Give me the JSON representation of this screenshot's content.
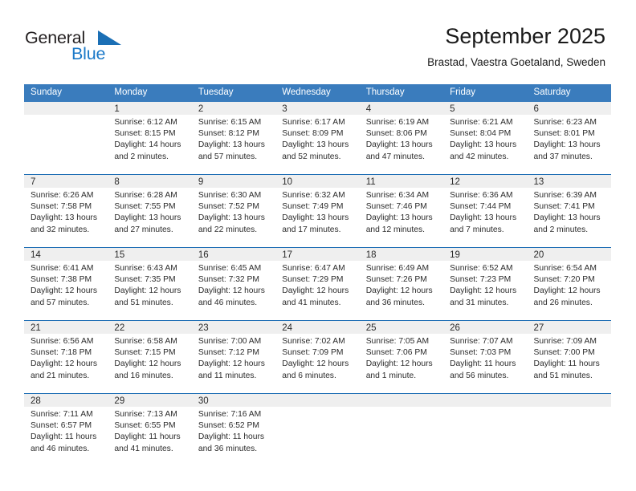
{
  "brand": {
    "name_part1": "General",
    "name_part2": "Blue",
    "triangle_icon": "triangle-icon",
    "color_dark": "#231f20",
    "color_blue": "#1b79c8"
  },
  "header": {
    "title": "September 2025",
    "subtitle": "Brastad, Vaestra Goetaland, Sweden"
  },
  "theme": {
    "header_bg": "#3a7cbd",
    "week_separator": "#1f6fb5",
    "daynum_bg": "#efefef",
    "text": "#2b2b2b"
  },
  "calendar": {
    "weekday_headers": [
      "Sunday",
      "Monday",
      "Tuesday",
      "Wednesday",
      "Thursday",
      "Friday",
      "Saturday"
    ],
    "weeks": [
      [
        {
          "day": "",
          "sunrise": "",
          "sunset": "",
          "daylight_line1": "",
          "daylight_line2": "",
          "empty": true,
          "shaded": true
        },
        {
          "day": "1",
          "sunrise": "Sunrise: 6:12 AM",
          "sunset": "Sunset: 8:15 PM",
          "daylight_line1": "Daylight: 14 hours",
          "daylight_line2": "and 2 minutes."
        },
        {
          "day": "2",
          "sunrise": "Sunrise: 6:15 AM",
          "sunset": "Sunset: 8:12 PM",
          "daylight_line1": "Daylight: 13 hours",
          "daylight_line2": "and 57 minutes."
        },
        {
          "day": "3",
          "sunrise": "Sunrise: 6:17 AM",
          "sunset": "Sunset: 8:09 PM",
          "daylight_line1": "Daylight: 13 hours",
          "daylight_line2": "and 52 minutes."
        },
        {
          "day": "4",
          "sunrise": "Sunrise: 6:19 AM",
          "sunset": "Sunset: 8:06 PM",
          "daylight_line1": "Daylight: 13 hours",
          "daylight_line2": "and 47 minutes."
        },
        {
          "day": "5",
          "sunrise": "Sunrise: 6:21 AM",
          "sunset": "Sunset: 8:04 PM",
          "daylight_line1": "Daylight: 13 hours",
          "daylight_line2": "and 42 minutes."
        },
        {
          "day": "6",
          "sunrise": "Sunrise: 6:23 AM",
          "sunset": "Sunset: 8:01 PM",
          "daylight_line1": "Daylight: 13 hours",
          "daylight_line2": "and 37 minutes."
        }
      ],
      [
        {
          "day": "7",
          "sunrise": "Sunrise: 6:26 AM",
          "sunset": "Sunset: 7:58 PM",
          "daylight_line1": "Daylight: 13 hours",
          "daylight_line2": "and 32 minutes."
        },
        {
          "day": "8",
          "sunrise": "Sunrise: 6:28 AM",
          "sunset": "Sunset: 7:55 PM",
          "daylight_line1": "Daylight: 13 hours",
          "daylight_line2": "and 27 minutes."
        },
        {
          "day": "9",
          "sunrise": "Sunrise: 6:30 AM",
          "sunset": "Sunset: 7:52 PM",
          "daylight_line1": "Daylight: 13 hours",
          "daylight_line2": "and 22 minutes."
        },
        {
          "day": "10",
          "sunrise": "Sunrise: 6:32 AM",
          "sunset": "Sunset: 7:49 PM",
          "daylight_line1": "Daylight: 13 hours",
          "daylight_line2": "and 17 minutes."
        },
        {
          "day": "11",
          "sunrise": "Sunrise: 6:34 AM",
          "sunset": "Sunset: 7:46 PM",
          "daylight_line1": "Daylight: 13 hours",
          "daylight_line2": "and 12 minutes."
        },
        {
          "day": "12",
          "sunrise": "Sunrise: 6:36 AM",
          "sunset": "Sunset: 7:44 PM",
          "daylight_line1": "Daylight: 13 hours",
          "daylight_line2": "and 7 minutes."
        },
        {
          "day": "13",
          "sunrise": "Sunrise: 6:39 AM",
          "sunset": "Sunset: 7:41 PM",
          "daylight_line1": "Daylight: 13 hours",
          "daylight_line2": "and 2 minutes."
        }
      ],
      [
        {
          "day": "14",
          "sunrise": "Sunrise: 6:41 AM",
          "sunset": "Sunset: 7:38 PM",
          "daylight_line1": "Daylight: 12 hours",
          "daylight_line2": "and 57 minutes."
        },
        {
          "day": "15",
          "sunrise": "Sunrise: 6:43 AM",
          "sunset": "Sunset: 7:35 PM",
          "daylight_line1": "Daylight: 12 hours",
          "daylight_line2": "and 51 minutes."
        },
        {
          "day": "16",
          "sunrise": "Sunrise: 6:45 AM",
          "sunset": "Sunset: 7:32 PM",
          "daylight_line1": "Daylight: 12 hours",
          "daylight_line2": "and 46 minutes."
        },
        {
          "day": "17",
          "sunrise": "Sunrise: 6:47 AM",
          "sunset": "Sunset: 7:29 PM",
          "daylight_line1": "Daylight: 12 hours",
          "daylight_line2": "and 41 minutes."
        },
        {
          "day": "18",
          "sunrise": "Sunrise: 6:49 AM",
          "sunset": "Sunset: 7:26 PM",
          "daylight_line1": "Daylight: 12 hours",
          "daylight_line2": "and 36 minutes."
        },
        {
          "day": "19",
          "sunrise": "Sunrise: 6:52 AM",
          "sunset": "Sunset: 7:23 PM",
          "daylight_line1": "Daylight: 12 hours",
          "daylight_line2": "and 31 minutes."
        },
        {
          "day": "20",
          "sunrise": "Sunrise: 6:54 AM",
          "sunset": "Sunset: 7:20 PM",
          "daylight_line1": "Daylight: 12 hours",
          "daylight_line2": "and 26 minutes."
        }
      ],
      [
        {
          "day": "21",
          "sunrise": "Sunrise: 6:56 AM",
          "sunset": "Sunset: 7:18 PM",
          "daylight_line1": "Daylight: 12 hours",
          "daylight_line2": "and 21 minutes."
        },
        {
          "day": "22",
          "sunrise": "Sunrise: 6:58 AM",
          "sunset": "Sunset: 7:15 PM",
          "daylight_line1": "Daylight: 12 hours",
          "daylight_line2": "and 16 minutes."
        },
        {
          "day": "23",
          "sunrise": "Sunrise: 7:00 AM",
          "sunset": "Sunset: 7:12 PM",
          "daylight_line1": "Daylight: 12 hours",
          "daylight_line2": "and 11 minutes."
        },
        {
          "day": "24",
          "sunrise": "Sunrise: 7:02 AM",
          "sunset": "Sunset: 7:09 PM",
          "daylight_line1": "Daylight: 12 hours",
          "daylight_line2": "and 6 minutes."
        },
        {
          "day": "25",
          "sunrise": "Sunrise: 7:05 AM",
          "sunset": "Sunset: 7:06 PM",
          "daylight_line1": "Daylight: 12 hours",
          "daylight_line2": "and 1 minute."
        },
        {
          "day": "26",
          "sunrise": "Sunrise: 7:07 AM",
          "sunset": "Sunset: 7:03 PM",
          "daylight_line1": "Daylight: 11 hours",
          "daylight_line2": "and 56 minutes."
        },
        {
          "day": "27",
          "sunrise": "Sunrise: 7:09 AM",
          "sunset": "Sunset: 7:00 PM",
          "daylight_line1": "Daylight: 11 hours",
          "daylight_line2": "and 51 minutes."
        }
      ],
      [
        {
          "day": "28",
          "sunrise": "Sunrise: 7:11 AM",
          "sunset": "Sunset: 6:57 PM",
          "daylight_line1": "Daylight: 11 hours",
          "daylight_line2": "and 46 minutes."
        },
        {
          "day": "29",
          "sunrise": "Sunrise: 7:13 AM",
          "sunset": "Sunset: 6:55 PM",
          "daylight_line1": "Daylight: 11 hours",
          "daylight_line2": "and 41 minutes."
        },
        {
          "day": "30",
          "sunrise": "Sunrise: 7:16 AM",
          "sunset": "Sunset: 6:52 PM",
          "daylight_line1": "Daylight: 11 hours",
          "daylight_line2": "and 36 minutes."
        },
        {
          "day": "",
          "sunrise": "",
          "sunset": "",
          "daylight_line1": "",
          "daylight_line2": "",
          "empty": true,
          "shaded": true
        },
        {
          "day": "",
          "sunrise": "",
          "sunset": "",
          "daylight_line1": "",
          "daylight_line2": "",
          "empty": true,
          "shaded": true
        },
        {
          "day": "",
          "sunrise": "",
          "sunset": "",
          "daylight_line1": "",
          "daylight_line2": "",
          "empty": true,
          "shaded": true
        },
        {
          "day": "",
          "sunrise": "",
          "sunset": "",
          "daylight_line1": "",
          "daylight_line2": "",
          "empty": true,
          "shaded": true
        }
      ]
    ]
  }
}
